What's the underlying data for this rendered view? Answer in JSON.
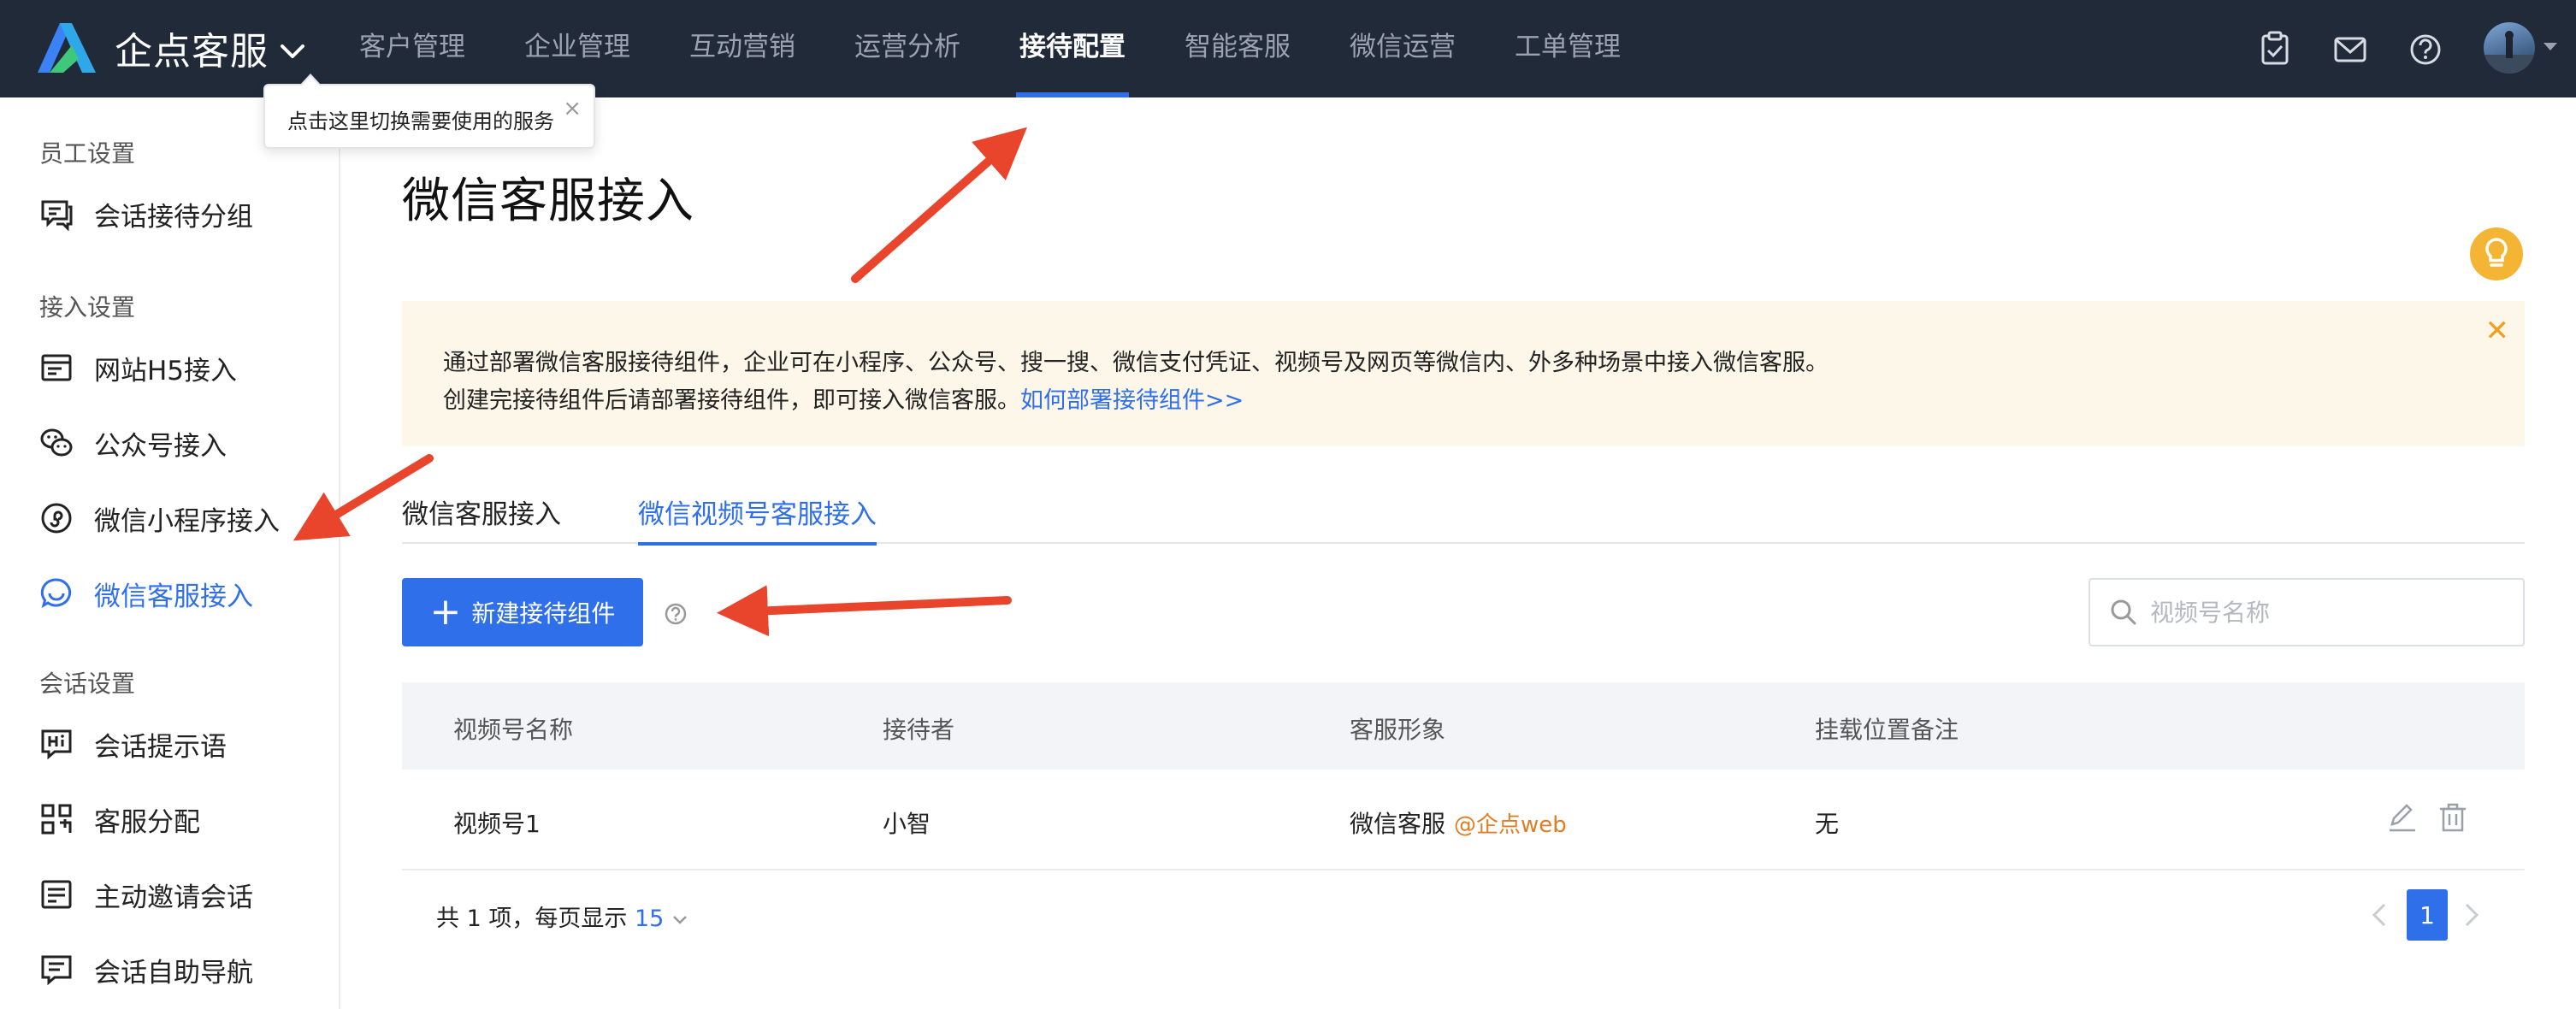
{
  "brand": {
    "name": "企点客服"
  },
  "tooltip": {
    "text": "点击这里切换需要使用的服务",
    "close": "×"
  },
  "nav": {
    "items": [
      {
        "label": "客户管理"
      },
      {
        "label": "企业管理"
      },
      {
        "label": "互动营销"
      },
      {
        "label": "运营分析"
      },
      {
        "label": "接待配置",
        "active": true
      },
      {
        "label": "智能客服"
      },
      {
        "label": "微信运营"
      },
      {
        "label": "工单管理"
      }
    ]
  },
  "top_icons": [
    "task-check-icon",
    "mail-icon",
    "help-circle-icon"
  ],
  "sidebar": {
    "sections": [
      {
        "title": "员工设置",
        "items": [
          {
            "label": "会话接待分组",
            "icon": "chat-group-icon"
          }
        ]
      },
      {
        "title": "接入设置",
        "items": [
          {
            "label": "网站H5接入",
            "icon": "web-icon"
          },
          {
            "label": "公众号接入",
            "icon": "wechat-official-icon"
          },
          {
            "label": "微信小程序接入",
            "icon": "mini-program-icon"
          },
          {
            "label": "微信客服接入",
            "icon": "wechat-service-icon",
            "active": true
          }
        ]
      },
      {
        "title": "会话设置",
        "items": [
          {
            "label": "会话提示语",
            "icon": "hi-icon"
          },
          {
            "label": "客服分配",
            "icon": "assign-icon"
          },
          {
            "label": "主动邀请会话",
            "icon": "invite-icon"
          },
          {
            "label": "会话自助导航",
            "icon": "nav-icon"
          }
        ]
      }
    ]
  },
  "page": {
    "title": "微信客服接入"
  },
  "notice": {
    "line1": "通过部署微信客服接待组件，企业可在小程序、公众号、搜一搜、微信支付凭证、视频号及网页等微信内、外多种场景中接入微信客服。",
    "line2": "创建完接待组件后请部署接待组件，即可接入微信客服。",
    "link": "如何部署接待组件>>",
    "close": "✕"
  },
  "tabs": [
    {
      "label": "微信客服接入"
    },
    {
      "label": "微信视频号客服接入",
      "active": true
    }
  ],
  "toolbar": {
    "new_label": "新建接待组件",
    "plus": "+"
  },
  "search": {
    "placeholder": "视频号名称",
    "value": ""
  },
  "table": {
    "columns": [
      "视频号名称",
      "接待者",
      "客服形象",
      "挂载位置备注"
    ],
    "rows": [
      {
        "name": "视频号1",
        "receiver": "小智",
        "avatar": "微信客服",
        "avatar_tag": "@企点web",
        "note": "无"
      }
    ]
  },
  "pagination": {
    "total_text": "共 1 项，每页显示",
    "page_size": "15",
    "current_page": "1"
  },
  "colors": {
    "accent": "#2f6fea",
    "nav_bg": "#212a39",
    "notice_bg": "#fdf7ea",
    "annotation": "#e8452c",
    "tag": "#e07d22"
  }
}
